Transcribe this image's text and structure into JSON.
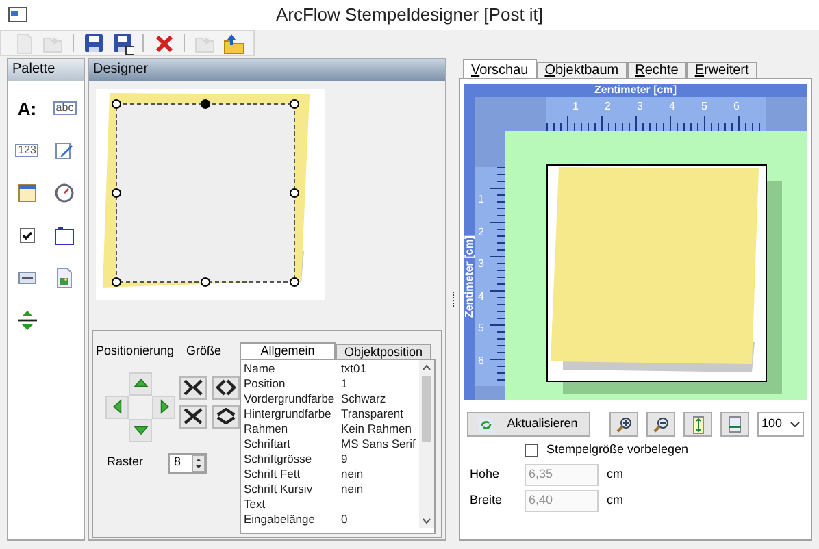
{
  "window": {
    "title": "ArcFlow Stempeldesigner [Post it]"
  },
  "toolbar": [
    {
      "kind": "new",
      "disabled": true,
      "separator_before": false
    },
    {
      "kind": "open",
      "disabled": true,
      "separator_before": false
    },
    {
      "kind": "save",
      "disabled": false,
      "separator_before": true
    },
    {
      "kind": "save_as",
      "disabled": false,
      "separator_before": false
    },
    {
      "kind": "delete",
      "disabled": false,
      "separator_before": true
    },
    {
      "kind": "import",
      "disabled": true,
      "separator_before": true
    },
    {
      "kind": "export",
      "disabled": false,
      "separator_before": false
    }
  ],
  "palette": {
    "title": "Palette",
    "items": [
      {
        "kind": "label",
        "glyph": "A:"
      },
      {
        "kind": "textbox",
        "glyph": "abc"
      },
      {
        "kind": "number",
        "glyph": "123"
      },
      {
        "kind": "edit"
      },
      {
        "kind": "date"
      },
      {
        "kind": "time"
      },
      {
        "kind": "checkbox"
      },
      {
        "kind": "frame"
      },
      {
        "kind": "field"
      },
      {
        "kind": "image"
      },
      {
        "kind": "spacer"
      }
    ]
  },
  "designer": {
    "title": "Designer",
    "positioning_label": "Positionierung",
    "size_label": "Größe",
    "raster": {
      "label": "Raster",
      "value": "8"
    },
    "properties": {
      "tabs": [
        {
          "label": "Allgemein",
          "selected": true
        },
        {
          "label": "Objektposition",
          "selected": false
        }
      ],
      "rows": [
        {
          "name": "Name",
          "value": "txt01"
        },
        {
          "name": "Position",
          "value": "1"
        },
        {
          "name": "Vordergrundfarbe",
          "value": "Schwarz"
        },
        {
          "name": "Hintergrundfarbe",
          "value": "Transparent"
        },
        {
          "name": "Rahmen",
          "value": "Kein Rahmen"
        },
        {
          "name": "Schriftart",
          "value": "MS Sans Serif"
        },
        {
          "name": "Schriftgrösse",
          "value": "9"
        },
        {
          "name": "Schrift Fett",
          "value": "nein"
        },
        {
          "name": "Schrift Kursiv",
          "value": "nein"
        },
        {
          "name": "Text"
        },
        {
          "name": "Eingabelänge",
          "value": "0"
        }
      ]
    }
  },
  "preview_panel": {
    "tabs": [
      {
        "label": "Vorschau",
        "selected": true
      },
      {
        "label": "Objektbaum",
        "selected": false
      },
      {
        "label": "Rechte",
        "selected": false
      },
      {
        "label": "Erweitert",
        "selected": false
      }
    ],
    "ruler": {
      "title": "Zentimeter [cm]",
      "labels": [
        "1",
        "2",
        "3",
        "4",
        "5",
        "6"
      ],
      "vertical_title": "Zentimeter [cm]",
      "vertical_labels": [
        "1",
        "2",
        "3",
        "4",
        "5",
        "6"
      ]
    },
    "refresh_button": "Aktualisieren",
    "zoom": "100",
    "preset_size": {
      "label": "Stempelgröße vorbelegen",
      "checked": false
    },
    "fields": [
      {
        "label": "Höhe",
        "value": "6,35",
        "unit": "cm",
        "disabled": true
      },
      {
        "label": "Breite",
        "value": "6,40",
        "unit": "cm",
        "disabled": true
      }
    ]
  }
}
